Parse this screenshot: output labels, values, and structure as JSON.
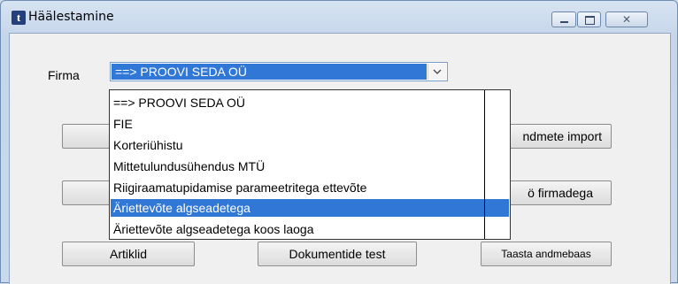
{
  "window": {
    "title": "Häälestamine",
    "logo": "t"
  },
  "window_controls": {
    "minimize_icon": "minimize-icon",
    "maximize_icon": "maximize-icon",
    "close_icon": "close-icon",
    "close_glyph": "✕"
  },
  "form": {
    "firma_label": "Firma",
    "firma_selected": "==> PROOVI SEDA OÜ",
    "dropdown_arrow_icon": "chevron-down-icon"
  },
  "dropdown": {
    "options": [
      "==> PROOVI SEDA OÜ",
      "FIE",
      "Korteriühistu",
      "Mittetulundusühendus MTÜ",
      "Riigiraamatupidamise parameetritega ettevõte",
      "Äriettevõte algseadetega",
      "Äriettevõte algseadetega koos laoga"
    ],
    "selected_index": 5
  },
  "buttons": {
    "row1_left_partial": "S",
    "row1_right_partial": "ndmete import",
    "row2_left_partial": "K",
    "row2_right_partial": "ö firmadega",
    "artiklid": "Artiklid",
    "dokumentide_test": "Dokumentide test",
    "taasta_andmebaas": "Taasta andmebaas"
  },
  "colors": {
    "selection": "#3077d6",
    "window_frame": "#c9d8eb",
    "client_bg": "#f0f0f0"
  }
}
